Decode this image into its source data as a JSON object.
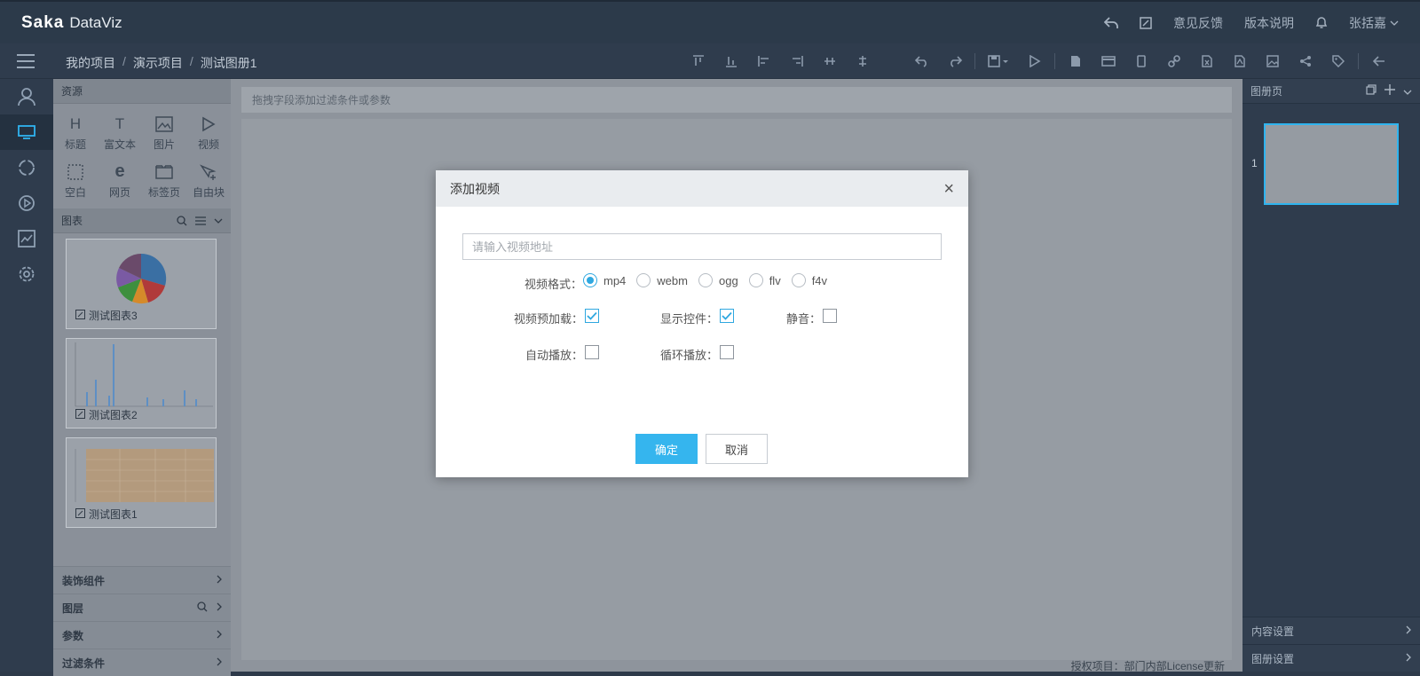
{
  "app": {
    "logo_mark": "Saka",
    "logo_name": "DataViz"
  },
  "topbar": {
    "feedback": "意见反馈",
    "version": "版本说明",
    "user": "张括嘉"
  },
  "breadcrumb": [
    "我的项目",
    "演示项目",
    "测试图册1"
  ],
  "breadcrumb_sep": "/",
  "left_panel": {
    "resources_title": "资源",
    "resources": [
      {
        "glyph": "H",
        "label": "标题"
      },
      {
        "glyph": "T",
        "label": "富文本"
      },
      {
        "glyph": "img",
        "label": "图片"
      },
      {
        "glyph": "play",
        "label": "视频"
      },
      {
        "glyph": "blank",
        "label": "空白"
      },
      {
        "glyph": "e",
        "label": "网页"
      },
      {
        "glyph": "tab",
        "label": "标签页"
      },
      {
        "glyph": "free",
        "label": "自由块"
      }
    ],
    "charts_title": "图表",
    "charts": [
      {
        "label": "测试图表3",
        "thumb": "pie-chart"
      },
      {
        "label": "测试图表2",
        "thumb": "bar-chart"
      },
      {
        "label": "测试图表1",
        "thumb": "table"
      }
    ],
    "sections": [
      "装饰组件",
      "图层",
      "参数",
      "过滤条件"
    ]
  },
  "canvas": {
    "filter_hint": "拖拽字段添加过滤条件或参数",
    "license": "授权项目：部门内部License更新"
  },
  "right_panel": {
    "title": "图册页",
    "page_number": "1",
    "content_settings": "内容设置",
    "album_settings": "图册设置"
  },
  "modal": {
    "title": "添加视频",
    "close": "×",
    "url_placeholder": "请输入视频地址",
    "url_value": "",
    "format_label": "视频格式：",
    "formats": [
      "mp4",
      "webm",
      "ogg",
      "flv",
      "f4v"
    ],
    "selected_format": "mp4",
    "preload_label": "视频预加载：",
    "preload": true,
    "controls_label": "显示控件：",
    "controls": true,
    "mute_label": "静音：",
    "mute": false,
    "autoplay_label": "自动播放：",
    "autoplay": false,
    "loop_label": "循环播放：",
    "loop": false,
    "ok": "确定",
    "cancel": "取消"
  },
  "colors": {
    "accent": "#35b5ee",
    "topbar": "#2c3a4a",
    "active_rail": "#2fb4ef"
  }
}
